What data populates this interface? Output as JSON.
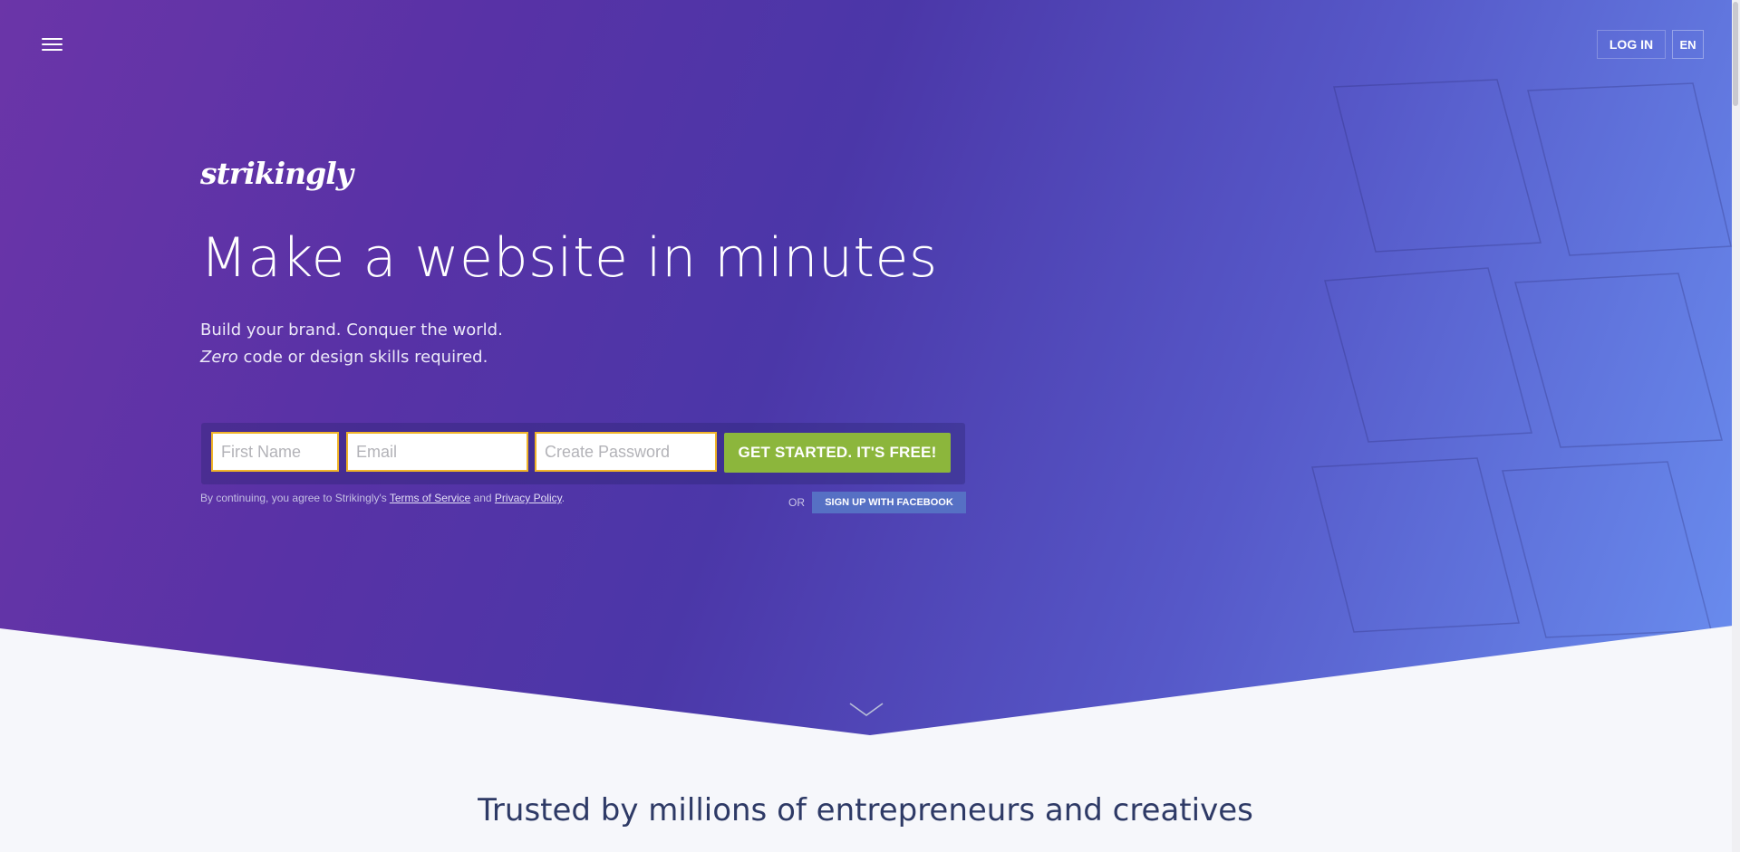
{
  "header": {
    "login_label": "LOG IN",
    "lang_label": "EN"
  },
  "brand": {
    "logo_text": "strikingly"
  },
  "hero": {
    "headline": "Make a website in minutes",
    "sub_line1": "Build your brand. Conquer the world.",
    "sub_line2_em": "Zero",
    "sub_line2_rest": " code or design skills required."
  },
  "signup": {
    "first_name_placeholder": "First Name",
    "email_placeholder": "Email",
    "password_placeholder": "Create Password",
    "cta_label": "GET STARTED. IT'S FREE!",
    "terms_prefix": "By continuing, you agree to Strikingly's ",
    "terms_link": "Terms of Service",
    "terms_and": " and ",
    "privacy_link": "Privacy Policy",
    "terms_suffix": ".",
    "or_label": "OR",
    "facebook_label": "SIGN UP WITH FACEBOOK"
  },
  "section": {
    "trusted_title": "Trusted by millions of entrepreneurs and creatives"
  },
  "colors": {
    "cta": "#8cb63c",
    "focus_border": "#f0b429",
    "facebook": "#5670c4"
  },
  "icons": {
    "menu": "hamburger-icon",
    "scroll": "chevron-down-icon"
  }
}
